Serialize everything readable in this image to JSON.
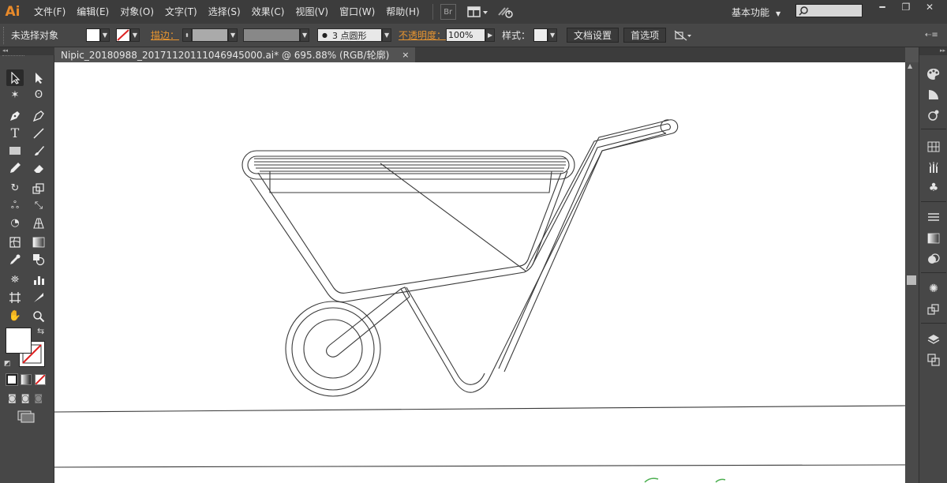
{
  "app": {
    "logo": "Ai",
    "brand_color": "#e88a2a"
  },
  "menu": [
    "文件(F)",
    "编辑(E)",
    "对象(O)",
    "文字(T)",
    "选择(S)",
    "效果(C)",
    "视图(V)",
    "窗口(W)",
    "帮助(H)"
  ],
  "menubar_extra": {
    "bridge": "Br",
    "workspace": "基本功能"
  },
  "control": {
    "selection": "未选择对象",
    "stroke_label": "描边：",
    "brush": "3 点圆形",
    "opacity_label": "不透明度：",
    "opacity": "100%",
    "style_label": "样式：",
    "doc_setup": "文档设置",
    "prefs": "首选项"
  },
  "document": {
    "tab_title": "Nipic_20180988_20171120111046945000.ai* @ 695.88% (RGB/轮廓)",
    "close": "×"
  },
  "icons": {
    "tools": [
      "selection-tool-icon",
      "direct-selection-tool-icon",
      "magic-wand-icon",
      "lasso-icon",
      "pen-tool-icon",
      "curvature-tool-icon",
      "type-tool-icon",
      "line-tool-icon",
      "rectangle-tool-icon",
      "paintbrush-icon",
      "pencil-tool-icon",
      "eraser-icon",
      "rotate-tool-icon",
      "scale-tool-icon",
      "warp-tool-icon",
      "free-transform-icon",
      "shape-builder-icon",
      "perspective-grid-icon",
      "mesh-tool-icon",
      "gradient-tool-icon",
      "eyedropper-icon",
      "blend-tool-icon",
      "symbol-sprayer-icon",
      "column-graph-icon",
      "artboard-tool-icon",
      "slice-tool-icon",
      "hand-tool-icon",
      "zoom-tool-icon"
    ],
    "right": [
      "color-panel-icon",
      "color-guide-icon",
      "appearance-icon",
      "swatches-icon",
      "brushes-icon",
      "symbols-icon",
      "stroke-panel-icon",
      "gradient-panel-icon",
      "transparency-icon",
      "graphic-styles-icon",
      "transform-icon",
      "layers-icon",
      "artboards-icon"
    ]
  }
}
